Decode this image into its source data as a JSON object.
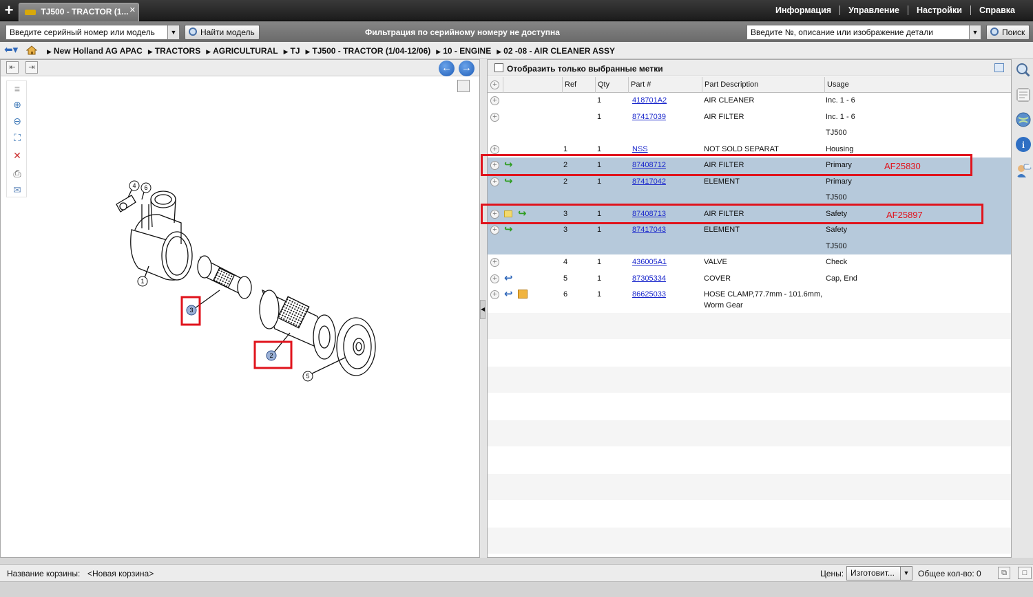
{
  "topbar": {
    "tab_title": "TJ500 - TRACTOR (1...",
    "menu": [
      "Информация",
      "Управление",
      "Настройки",
      "Справка"
    ]
  },
  "searchbar": {
    "serial_placeholder": "Введите серийный номер или модель",
    "find_model_label": "Найти модель",
    "filter_message": "Фильтрация по серийному номеру не доступна",
    "part_search_placeholder": "Введите №, описание или изображение детали",
    "search_label": "Поиск"
  },
  "breadcrumb": [
    "New Holland AG APAC",
    "TRACTORS",
    "AGRICULTURAL",
    "TJ",
    "TJ500 - TRACTOR (1/04-12/06)",
    "10 - ENGINE",
    "02 -08 - AIR CLEANER ASSY"
  ],
  "diagram": {
    "callouts": [
      "1",
      "2",
      "3",
      "4",
      "5",
      "6"
    ]
  },
  "parts": {
    "only_selected_label": "Отобразить только выбранные метки",
    "columns": [
      "Ref",
      "Qty",
      "Part #",
      "Part Description",
      "Usage"
    ],
    "rows": [
      {
        "ref": "",
        "qty": "1",
        "part": "418701A2",
        "desc": "AIR CLEANER",
        "usage": "Inc. 1 - 6",
        "icons": [],
        "style": "alt"
      },
      {
        "ref": "",
        "qty": "1",
        "part": "87417039",
        "desc": "AIR FILTER",
        "usage": "Inc. 1 - 6",
        "icons": [],
        "style": "alt"
      },
      {
        "ref": "",
        "qty": "",
        "part": "",
        "desc": "",
        "usage": "TJ500",
        "icons": [],
        "style": "alt",
        "noadd": true
      },
      {
        "ref": "1",
        "qty": "1",
        "part": "NSS",
        "desc": "NOT SOLD SEPARAT",
        "usage": "Housing",
        "icons": [],
        "style": "alt"
      },
      {
        "ref": "2",
        "qty": "1",
        "part": "87408712",
        "desc": "AIR FILTER",
        "usage": "Primary",
        "icons": [
          "green-arrow"
        ],
        "style": "sel"
      },
      {
        "ref": "2",
        "qty": "1",
        "part": "87417042",
        "desc": "ELEMENT",
        "usage": "Primary",
        "icons": [
          "green-arrow"
        ],
        "style": "sel"
      },
      {
        "ref": "",
        "qty": "",
        "part": "",
        "desc": "",
        "usage": "TJ500",
        "icons": [],
        "style": "sel",
        "noadd": true
      },
      {
        "ref": "3",
        "qty": "1",
        "part": "87408713",
        "desc": "AIR FILTER",
        "usage": "Safety",
        "icons": [
          "note",
          "green-arrow"
        ],
        "style": "sel"
      },
      {
        "ref": "3",
        "qty": "1",
        "part": "87417043",
        "desc": "ELEMENT",
        "usage": "Safety",
        "icons": [
          "green-arrow"
        ],
        "style": "sel"
      },
      {
        "ref": "",
        "qty": "",
        "part": "",
        "desc": "",
        "usage": "TJ500",
        "icons": [],
        "style": "sel",
        "noadd": true
      },
      {
        "ref": "4",
        "qty": "1",
        "part": "436005A1",
        "desc": "VALVE",
        "usage": "Check",
        "icons": [],
        "style": "alt"
      },
      {
        "ref": "5",
        "qty": "1",
        "part": "87305334",
        "desc": "COVER",
        "usage": "Cap, End",
        "icons": [
          "blue-arrow"
        ],
        "style": "alt"
      },
      {
        "ref": "6",
        "qty": "1",
        "part": "86625033",
        "desc": "HOSE CLAMP,77.7mm - 101.6mm,",
        "desc2": "Worm Gear",
        "usage": "",
        "icons": [
          "blue-arrow",
          "box"
        ],
        "style": "alt",
        "tall": true
      }
    ],
    "annotations": [
      "AF25830",
      "AF25897"
    ]
  },
  "bottombar": {
    "cart_label": "Название корзины:",
    "cart_name": "<Новая корзина>",
    "price_label": "Цены:",
    "price_value": "Изготовит...",
    "total_label": "Общее кол-во: 0"
  },
  "colors": {
    "highlight_red": "#e0131c",
    "selected_row": "#b6c9db",
    "link_blue": "#1a27cc"
  }
}
